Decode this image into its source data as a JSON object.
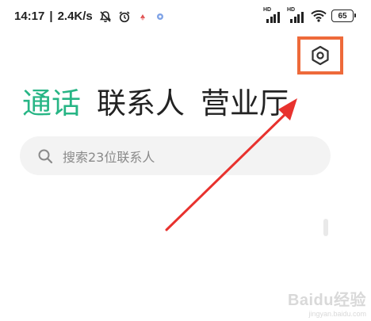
{
  "status_bar": {
    "time": "14:17",
    "separator": "|",
    "network_speed": "2.4K/s",
    "icons": [
      "bell-muted-icon",
      "alarm-clock-icon",
      "app-notification-icon",
      "app-notification-icon"
    ],
    "signal_labels": [
      "HD",
      "HD"
    ],
    "battery": "65"
  },
  "settings": {
    "icon": "settings-hexagon-icon",
    "highlight_color": "#ee6a3a"
  },
  "tabs": [
    {
      "label": "通话",
      "active": true
    },
    {
      "label": "联系人",
      "active": false
    },
    {
      "label": "营业厅",
      "active": false
    }
  ],
  "search": {
    "placeholder": "搜索23位联系人"
  },
  "colors": {
    "accent": "#27b585",
    "annotation": "#e8322e"
  },
  "watermark": {
    "text": "Baidu经验",
    "subtext": "jingyan.baidu.com"
  }
}
